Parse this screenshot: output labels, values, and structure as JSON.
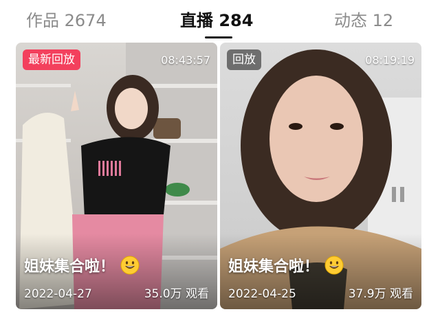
{
  "tabs": [
    {
      "label": "作品",
      "count": "2674",
      "active": false
    },
    {
      "label": "直播",
      "count": "284",
      "active": true
    },
    {
      "label": "动态",
      "count": "12",
      "active": false
    }
  ],
  "cards": [
    {
      "badge": "最新回放",
      "badge_color": "#f3405d",
      "duration": "08:43:57",
      "title": "姐妹集合啦！",
      "emoji": "grinning-face-emoji",
      "date": "2022-04-27",
      "views": "35.0万 观看"
    },
    {
      "badge": "回放",
      "duration": "08:19:19",
      "title": "姐妹集合啦！",
      "emoji": "grinning-face-emoji",
      "date": "2022-04-25",
      "views": "37.9万 观看"
    }
  ],
  "colors": {
    "active_tab": "#111111",
    "inactive_tab": "#8b8b8b",
    "accent": "#f3405d"
  }
}
